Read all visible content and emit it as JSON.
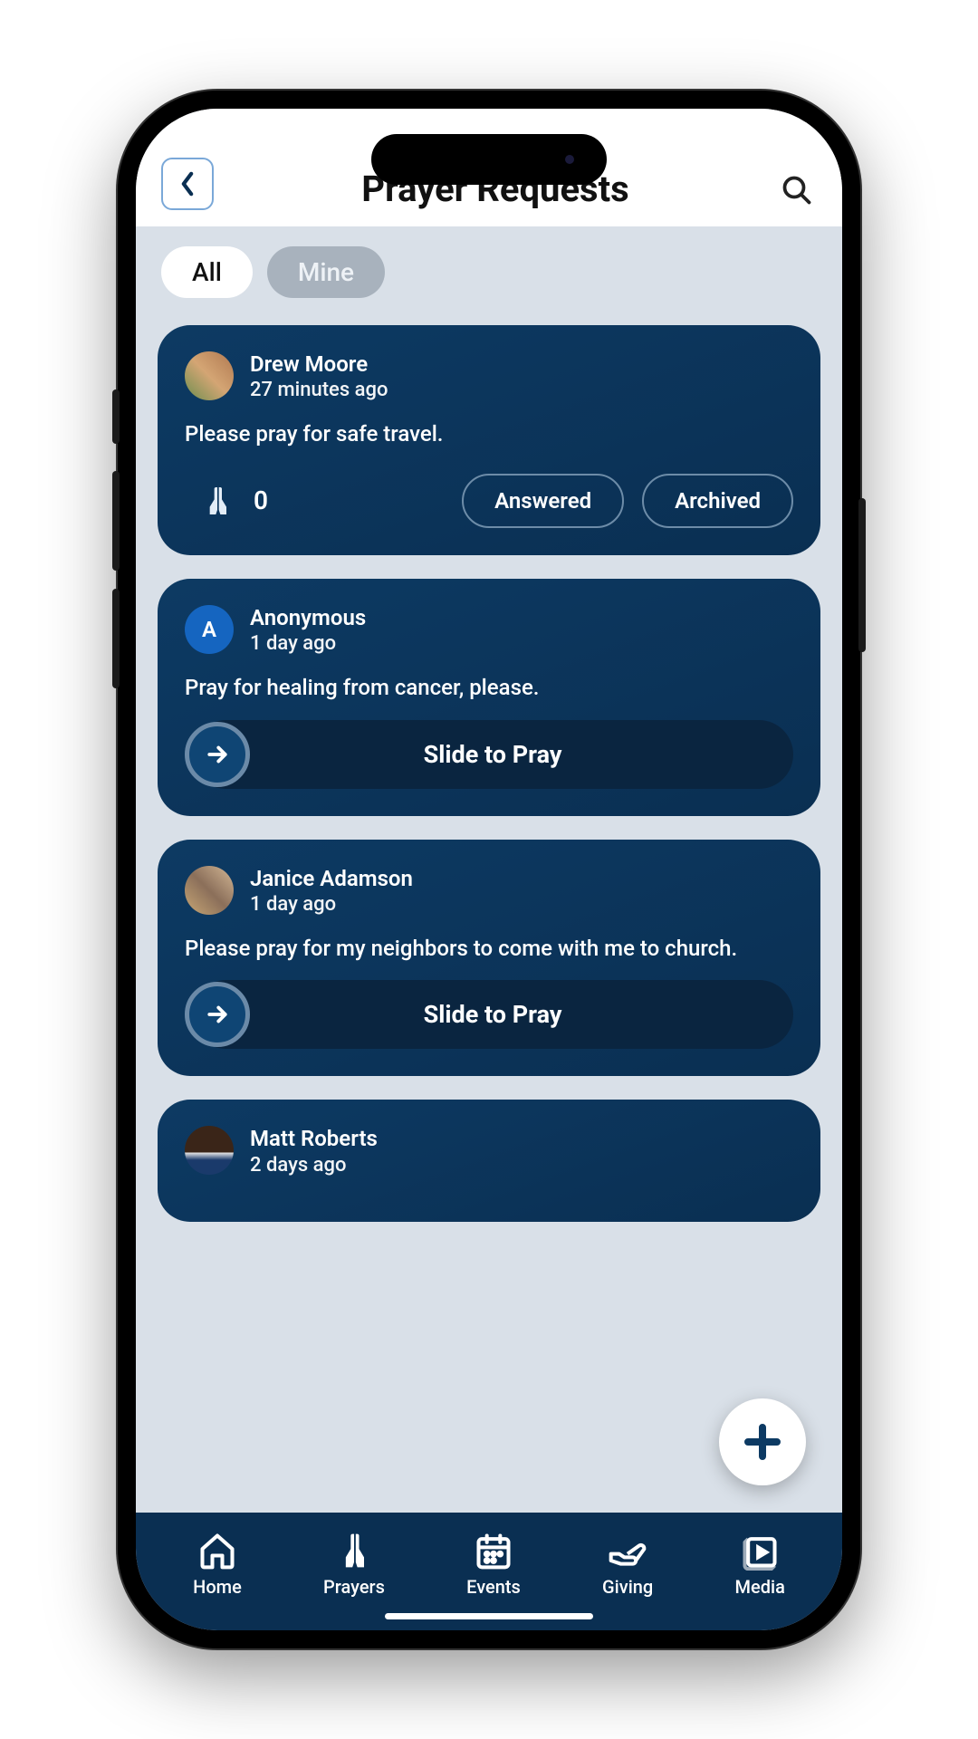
{
  "header": {
    "title": "Prayer Requests"
  },
  "tabs": {
    "all": "All",
    "mine": "Mine"
  },
  "requests": [
    {
      "author": "Drew Moore",
      "time": "27 minutes ago",
      "body": "Please pray for safe travel.",
      "pray_count": "0",
      "answered_label": "Answered",
      "archived_label": "Archived"
    },
    {
      "author": "Anonymous",
      "initial": "A",
      "time": "1 day ago",
      "body": "Pray for healing from cancer, please.",
      "slide_label": "Slide to Pray"
    },
    {
      "author": "Janice Adamson",
      "time": "1 day ago",
      "body": "Please pray for my neighbors to come with me to church.",
      "slide_label": "Slide to Pray"
    },
    {
      "author": "Matt Roberts",
      "time": "2 days ago"
    }
  ],
  "nav": {
    "home": "Home",
    "prayers": "Prayers",
    "events": "Events",
    "giving": "Giving",
    "media": "Media"
  }
}
